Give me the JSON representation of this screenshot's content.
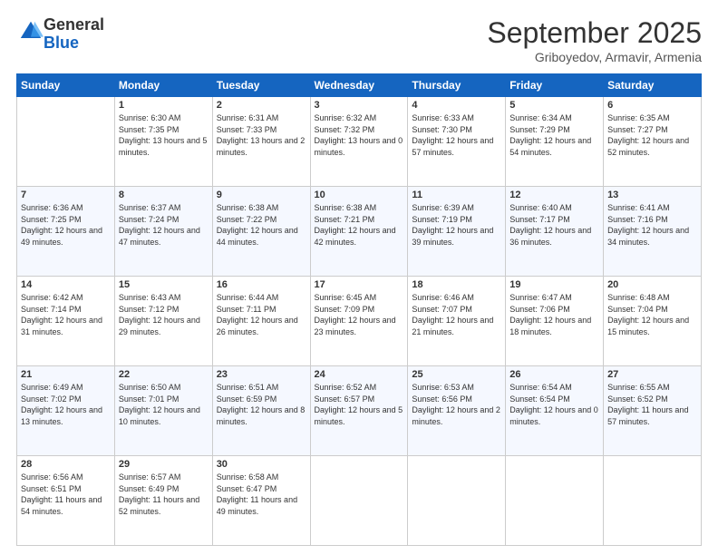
{
  "logo": {
    "general": "General",
    "blue": "Blue"
  },
  "header": {
    "month": "September 2025",
    "location": "Griboyedov, Armavir, Armenia"
  },
  "weekdays": [
    "Sunday",
    "Monday",
    "Tuesday",
    "Wednesday",
    "Thursday",
    "Friday",
    "Saturday"
  ],
  "weeks": [
    [
      {
        "day": "",
        "sunrise": "",
        "sunset": "",
        "daylight": ""
      },
      {
        "day": "1",
        "sunrise": "Sunrise: 6:30 AM",
        "sunset": "Sunset: 7:35 PM",
        "daylight": "Daylight: 13 hours and 5 minutes."
      },
      {
        "day": "2",
        "sunrise": "Sunrise: 6:31 AM",
        "sunset": "Sunset: 7:33 PM",
        "daylight": "Daylight: 13 hours and 2 minutes."
      },
      {
        "day": "3",
        "sunrise": "Sunrise: 6:32 AM",
        "sunset": "Sunset: 7:32 PM",
        "daylight": "Daylight: 13 hours and 0 minutes."
      },
      {
        "day": "4",
        "sunrise": "Sunrise: 6:33 AM",
        "sunset": "Sunset: 7:30 PM",
        "daylight": "Daylight: 12 hours and 57 minutes."
      },
      {
        "day": "5",
        "sunrise": "Sunrise: 6:34 AM",
        "sunset": "Sunset: 7:29 PM",
        "daylight": "Daylight: 12 hours and 54 minutes."
      },
      {
        "day": "6",
        "sunrise": "Sunrise: 6:35 AM",
        "sunset": "Sunset: 7:27 PM",
        "daylight": "Daylight: 12 hours and 52 minutes."
      }
    ],
    [
      {
        "day": "7",
        "sunrise": "Sunrise: 6:36 AM",
        "sunset": "Sunset: 7:25 PM",
        "daylight": "Daylight: 12 hours and 49 minutes."
      },
      {
        "day": "8",
        "sunrise": "Sunrise: 6:37 AM",
        "sunset": "Sunset: 7:24 PM",
        "daylight": "Daylight: 12 hours and 47 minutes."
      },
      {
        "day": "9",
        "sunrise": "Sunrise: 6:38 AM",
        "sunset": "Sunset: 7:22 PM",
        "daylight": "Daylight: 12 hours and 44 minutes."
      },
      {
        "day": "10",
        "sunrise": "Sunrise: 6:38 AM",
        "sunset": "Sunset: 7:21 PM",
        "daylight": "Daylight: 12 hours and 42 minutes."
      },
      {
        "day": "11",
        "sunrise": "Sunrise: 6:39 AM",
        "sunset": "Sunset: 7:19 PM",
        "daylight": "Daylight: 12 hours and 39 minutes."
      },
      {
        "day": "12",
        "sunrise": "Sunrise: 6:40 AM",
        "sunset": "Sunset: 7:17 PM",
        "daylight": "Daylight: 12 hours and 36 minutes."
      },
      {
        "day": "13",
        "sunrise": "Sunrise: 6:41 AM",
        "sunset": "Sunset: 7:16 PM",
        "daylight": "Daylight: 12 hours and 34 minutes."
      }
    ],
    [
      {
        "day": "14",
        "sunrise": "Sunrise: 6:42 AM",
        "sunset": "Sunset: 7:14 PM",
        "daylight": "Daylight: 12 hours and 31 minutes."
      },
      {
        "day": "15",
        "sunrise": "Sunrise: 6:43 AM",
        "sunset": "Sunset: 7:12 PM",
        "daylight": "Daylight: 12 hours and 29 minutes."
      },
      {
        "day": "16",
        "sunrise": "Sunrise: 6:44 AM",
        "sunset": "Sunset: 7:11 PM",
        "daylight": "Daylight: 12 hours and 26 minutes."
      },
      {
        "day": "17",
        "sunrise": "Sunrise: 6:45 AM",
        "sunset": "Sunset: 7:09 PM",
        "daylight": "Daylight: 12 hours and 23 minutes."
      },
      {
        "day": "18",
        "sunrise": "Sunrise: 6:46 AM",
        "sunset": "Sunset: 7:07 PM",
        "daylight": "Daylight: 12 hours and 21 minutes."
      },
      {
        "day": "19",
        "sunrise": "Sunrise: 6:47 AM",
        "sunset": "Sunset: 7:06 PM",
        "daylight": "Daylight: 12 hours and 18 minutes."
      },
      {
        "day": "20",
        "sunrise": "Sunrise: 6:48 AM",
        "sunset": "Sunset: 7:04 PM",
        "daylight": "Daylight: 12 hours and 15 minutes."
      }
    ],
    [
      {
        "day": "21",
        "sunrise": "Sunrise: 6:49 AM",
        "sunset": "Sunset: 7:02 PM",
        "daylight": "Daylight: 12 hours and 13 minutes."
      },
      {
        "day": "22",
        "sunrise": "Sunrise: 6:50 AM",
        "sunset": "Sunset: 7:01 PM",
        "daylight": "Daylight: 12 hours and 10 minutes."
      },
      {
        "day": "23",
        "sunrise": "Sunrise: 6:51 AM",
        "sunset": "Sunset: 6:59 PM",
        "daylight": "Daylight: 12 hours and 8 minutes."
      },
      {
        "day": "24",
        "sunrise": "Sunrise: 6:52 AM",
        "sunset": "Sunset: 6:57 PM",
        "daylight": "Daylight: 12 hours and 5 minutes."
      },
      {
        "day": "25",
        "sunrise": "Sunrise: 6:53 AM",
        "sunset": "Sunset: 6:56 PM",
        "daylight": "Daylight: 12 hours and 2 minutes."
      },
      {
        "day": "26",
        "sunrise": "Sunrise: 6:54 AM",
        "sunset": "Sunset: 6:54 PM",
        "daylight": "Daylight: 12 hours and 0 minutes."
      },
      {
        "day": "27",
        "sunrise": "Sunrise: 6:55 AM",
        "sunset": "Sunset: 6:52 PM",
        "daylight": "Daylight: 11 hours and 57 minutes."
      }
    ],
    [
      {
        "day": "28",
        "sunrise": "Sunrise: 6:56 AM",
        "sunset": "Sunset: 6:51 PM",
        "daylight": "Daylight: 11 hours and 54 minutes."
      },
      {
        "day": "29",
        "sunrise": "Sunrise: 6:57 AM",
        "sunset": "Sunset: 6:49 PM",
        "daylight": "Daylight: 11 hours and 52 minutes."
      },
      {
        "day": "30",
        "sunrise": "Sunrise: 6:58 AM",
        "sunset": "Sunset: 6:47 PM",
        "daylight": "Daylight: 11 hours and 49 minutes."
      },
      {
        "day": "",
        "sunrise": "",
        "sunset": "",
        "daylight": ""
      },
      {
        "day": "",
        "sunrise": "",
        "sunset": "",
        "daylight": ""
      },
      {
        "day": "",
        "sunrise": "",
        "sunset": "",
        "daylight": ""
      },
      {
        "day": "",
        "sunrise": "",
        "sunset": "",
        "daylight": ""
      }
    ]
  ]
}
